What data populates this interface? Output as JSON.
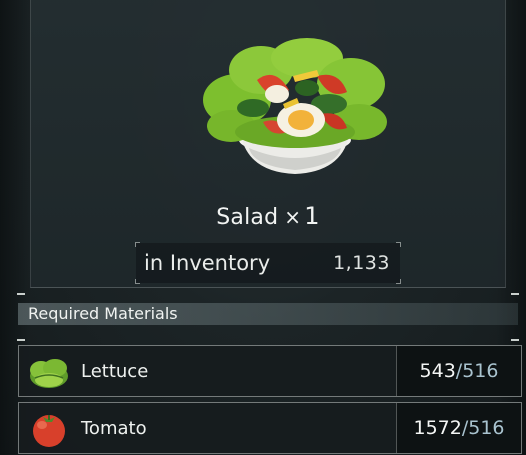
{
  "item": {
    "name": "Salad",
    "times_sign": "×",
    "quantity": "1",
    "inventory_label": "in Inventory",
    "inventory_count": "1,133",
    "icon": "salad-bowl-icon"
  },
  "materials": {
    "title": "Required Materials",
    "items": [
      {
        "name": "Lettuce",
        "have": "543",
        "sep": "/",
        "need": "516",
        "icon": "lettuce-icon"
      },
      {
        "name": "Tomato",
        "have": "1572",
        "sep": "/",
        "need": "516",
        "icon": "tomato-icon"
      }
    ]
  },
  "colors": {
    "background": "#1c2426",
    "panel": "#242e31",
    "section_bar": "#6e7d80",
    "required_count": "#a9c3cf"
  }
}
